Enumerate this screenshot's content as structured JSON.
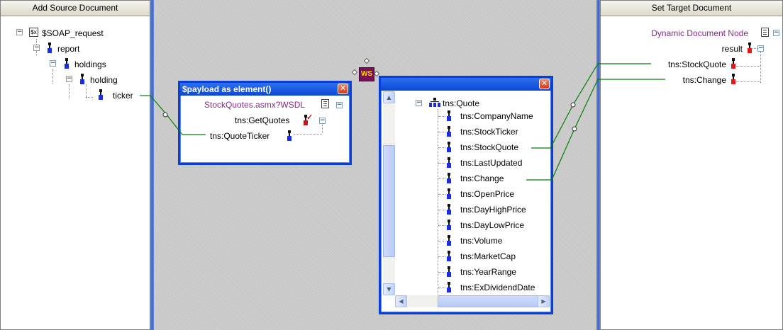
{
  "source_panel": {
    "header": "Add Source Document",
    "root_label": "$SOAP_request",
    "nodes": [
      "report",
      "holdings",
      "holding",
      "ticker"
    ]
  },
  "target_panel": {
    "header": "Set Target Document",
    "root_label": "Dynamic Document Node",
    "result_label": "result",
    "links": [
      "tns:StockQuote",
      "tns:Change"
    ]
  },
  "payload_window": {
    "title": "$payload as element()",
    "wsdl": "StockQuotes.asmx?WSDL",
    "operation": "tns:GetQuotes",
    "param": "tns:QuoteTicker"
  },
  "ws_icon_label": "WS",
  "quote_window": {
    "root": "tns:Quote",
    "fields": [
      "tns:CompanyName",
      "tns:StockTicker",
      "tns:StockQuote",
      "tns:LastUpdated",
      "tns:Change",
      "tns:OpenPrice",
      "tns:DayHighPrice",
      "tns:DayLowPrice",
      "tns:Volume",
      "tns:MarketCap",
      "tns:YearRange",
      "tns:ExDividendDate"
    ]
  },
  "colors": {
    "link_line": "#008000",
    "window_border": "#0a3fd6",
    "accent_purple": "#8a2a8a"
  }
}
